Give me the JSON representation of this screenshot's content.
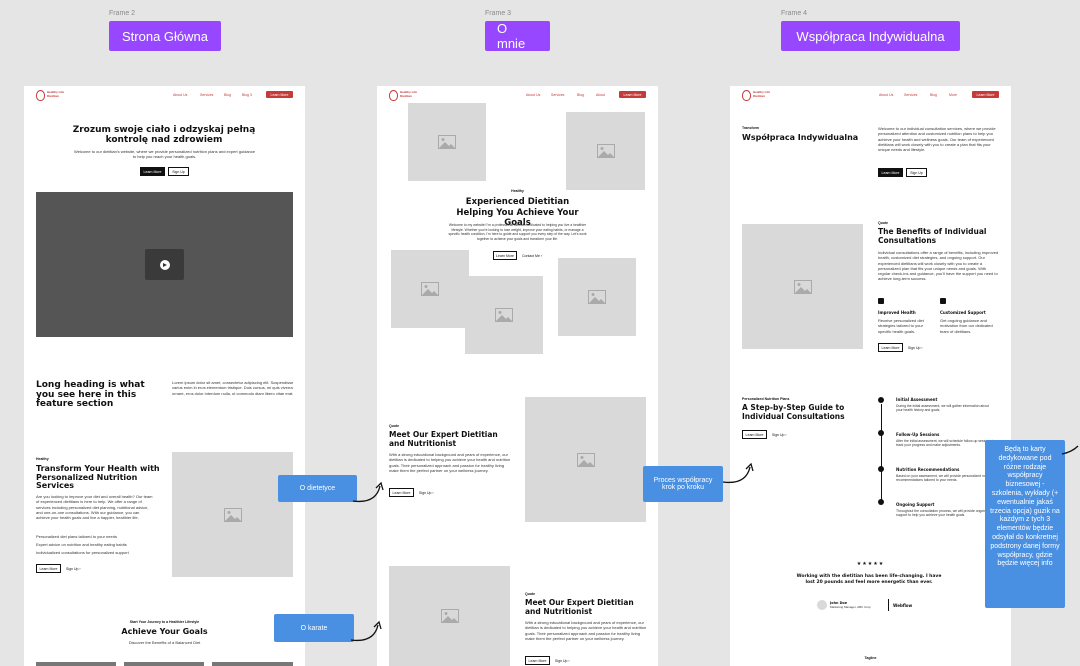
{
  "frames": [
    {
      "label": "Frame 2",
      "title": "Strona Główna"
    },
    {
      "label": "Frame 3",
      "title": "O mnie"
    },
    {
      "label": "Frame 4",
      "title": "Współpraca Indywidualna"
    }
  ],
  "nav": {
    "logo": "Healthy Life Dietitian",
    "f1": [
      "About Us",
      "Services",
      "Blog",
      "Blog 3"
    ],
    "f2": [
      "About Us",
      "Services",
      "Blog",
      "About"
    ],
    "f3": [
      "About Us",
      "Services",
      "Blog",
      "More"
    ],
    "cta": "Learn More"
  },
  "f1": {
    "hero_title": "Zrozum swoje ciało i odzyskaj pełną kontrolę nad zdrowiem",
    "hero_text": "Welcome to our dietitian's website, where we provide personalized nutrition plans and expert guidance to help you reach your health goals.",
    "btn_primary": "Learn More",
    "btn_secondary": "Sign Up",
    "long_heading": "Long heading is what you see here in this feature section",
    "long_text": "Lorem ipsum dolor sit amet, consectetur adipiscing elit. Suspendisse varius enim in eros elementum tristique. Duis cursus, mi quis viverra ornare, eros dolor interdum nulla, ut commodo diam libero vitae erat.",
    "tag": "Healthy",
    "transform_title": "Transform Your Health with Personalized Nutrition Services",
    "transform_text": "Are you looking to improve your diet and overall health? Our team of experienced dietitians is here to help. We offer a range of services including personalized diet planning, nutritional advice, and one-on-one consultations. With our guidance, you can achieve your health goals and live a happier, healthier life.",
    "bullets": [
      "Personalized diet plans tailored to your needs",
      "Expert advice on nutrition and healthy eating habits",
      "Individualized consultations for personalized support"
    ],
    "learn": "Learn More",
    "sign": "Sign Up",
    "journey_tag": "Start Your Journey to a Healthier Lifestyle",
    "goals_title": "Achieve Your Goals",
    "goals_sub": "Discover the Benefits of a Balanced Diet"
  },
  "f2": {
    "tag": "Healthy",
    "title": "Experienced Dietitian Helping You Achieve Your Goals",
    "text": "Welcome to my website! I'm a professional dietitian dedicated to helping you live a healthier lifestyle. Whether you're looking to lose weight, improve your eating habits, or manage a specific health condition, I'm here to guide and support you every step of the way. Let's work together to achieve your goals and transform your life.",
    "btn1": "Learn More",
    "btn2": "Contact Me",
    "quote_tag": "Quote",
    "meet_title": "Meet Our Expert Dietitian and Nutritionist",
    "meet_text": "With a strong educational background and years of experience, our dietitian is dedicated to helping you achieve your health and nutrition goals. Their personalized approach and passion for healthy living make them the perfect partner on your wellness journey.",
    "learn": "Learn More",
    "sign": "Sign Up"
  },
  "f3": {
    "tag": "Transform",
    "title": "Współpraca Indywidualna",
    "text": "Welcome to our individual consultation services, where we provide personalized attention and customized nutrition plans to help you achieve your health and wellness goals. Our team of experienced dietitians will work closely with you to create a plan that fits your unique needs and lifestyle.",
    "btn1": "Learn More",
    "btn2": "Sign Up",
    "quote_tag": "Quote",
    "benefits_title": "The Benefits of Individual Consultations",
    "benefits_text": "Individual consultations offer a range of benefits, including improved health, customized diet strategies, and ongoing support. Our experienced dietitians will work closely with you to create a personalized plan that fits your unique needs and goals. With regular check-ins and guidance, you'll have the support you need to achieve long-term success.",
    "f1_title": "Improved Health",
    "f1_text": "Receive personalized diet strategies tailored to your specific health goals.",
    "f2_title": "Customized Support",
    "f2_text": "Get ongoing guidance and motivation from our dedicated team of dietitians.",
    "learn": "Learn More",
    "sign": "Sign Up",
    "plans_tag": "Personalized Nutrition Plans",
    "steps_title": "A Step-by-Step Guide to Individual Consultations",
    "steps": [
      {
        "title": "Initial Assessment",
        "text": "During the initial assessment, we will gather information about your health history and goals."
      },
      {
        "title": "Follow-Up Sessions",
        "text": "After the initial assessment, we will schedule follow-up sessions to track your progress and make adjustments."
      },
      {
        "title": "Nutrition Recommendations",
        "text": "Based on your assessment, we will provide personalized nutrition recommendations tailored to your needs."
      },
      {
        "title": "Ongoing Support",
        "text": "Throughout the consultation process, we will provide ongoing support to help you achieve your health goals."
      }
    ],
    "stars": "★★★★★",
    "testimonial": "Working with the dietitian has been life-changing. I have lost 20 pounds and feel more energetic than ever.",
    "author": "John Doe",
    "author_role": "Marketing Manager, ABC Corp",
    "company": "Webflow",
    "tagline": "Tagline"
  },
  "annotations": {
    "dietetyce": "O dietetyce",
    "karate": "O karate",
    "proces": "Proces współpracy krok po kroku",
    "note": "Będą to karty dedykowane pod różne rodzaje współpracy biznesowej - szkolenia, wykłady (+ ewentualnie jakaś trzecia opcja) guzik na każdym z tych 3 elementów będzie odsyłał do konkretnej podstrony danej formy współpracy, gdzie będzie więcej info"
  }
}
